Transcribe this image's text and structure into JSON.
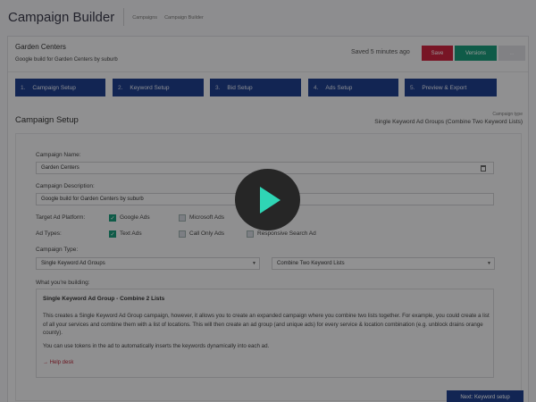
{
  "app": {
    "title": "Campaign Builder"
  },
  "breadcrumb": [
    "Campaigns",
    "Campaign Builder"
  ],
  "campaign": {
    "name": "Garden Centers",
    "description": "Google build for Garden Centers by suburb",
    "saved_status": "Saved 5 minutes ago"
  },
  "actions": {
    "save": "Save",
    "versions": "Versions",
    "more": "..."
  },
  "steps": [
    {
      "num": "1.",
      "label": "Campaign Setup"
    },
    {
      "num": "2.",
      "label": "Keyword Setup"
    },
    {
      "num": "3.",
      "label": "Bid Setup"
    },
    {
      "num": "4.",
      "label": "Ads Setup"
    },
    {
      "num": "5.",
      "label": "Preview & Export"
    }
  ],
  "section": {
    "title": "Campaign Setup",
    "campaign_type_label": "Campaign type",
    "campaign_type_value": "Single Keyword Ad Groups (Combine Two Keyword Lists)"
  },
  "form": {
    "name_label": "Campaign Name:",
    "name_value": "Garden Centers",
    "desc_label": "Campaign Description:",
    "desc_value": "Google build for Garden Centers by suburb",
    "platform_label": "Target Ad Platform:",
    "platforms": [
      {
        "label": "Google Ads",
        "checked": true
      },
      {
        "label": "Microsoft Ads",
        "checked": false
      }
    ],
    "adtypes_label": "Ad Types:",
    "adtypes": [
      {
        "label": "Text Ads",
        "checked": true
      },
      {
        "label": "Call Only Ads",
        "checked": false
      },
      {
        "label": "Responsive Search Ad",
        "checked": false
      }
    ],
    "type_label": "Campaign Type:",
    "type_select": "Single Keyword Ad Groups",
    "type_select2": "Combine Two Keyword Lists",
    "building_label": "What you're building:"
  },
  "info": {
    "title": "Single Keyword Ad Group - Combine 2 Lists",
    "body": "This creates a Single Keyword Ad Group campaign, however, it allows you to create an expanded campaign where you combine two lists together. For example, you could create a list of all your services and combine them with a list of locations. This will then create an ad group (and unique ads) for every service & location combination (e.g. unblock drains orange county).",
    "body2": "You can use tokens in the ad to automatically inserts the keywords dynamically into each ad.",
    "help": "→ Help desk"
  },
  "footer": {
    "next": "Next: Keyword setup"
  },
  "colors": {
    "primary": "#1f3f8a",
    "danger": "#c9233f",
    "success": "#1a9878",
    "play_icon": "#2fd5b5"
  },
  "icons": [
    "calendar-icon",
    "play-icon",
    "chevron-down-icon",
    "check-icon"
  ]
}
